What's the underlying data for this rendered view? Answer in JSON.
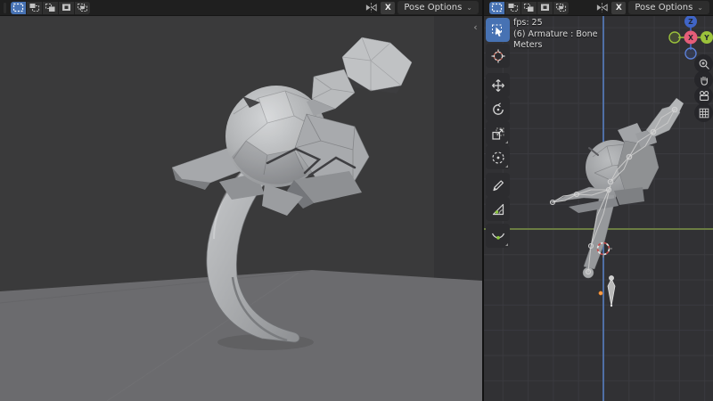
{
  "icons": {
    "chevron_down": "⌄",
    "sidebar_toggle": "‹"
  },
  "header": {
    "select_mode_tools": [
      "set",
      "extend",
      "subtract",
      "invert",
      "intersect"
    ],
    "mirror_axis_label": "X",
    "pose_options_label": "Pose Options"
  },
  "left_viewport": {
    "content": "shaded low-poly creature model on curved stand over gray floor plane"
  },
  "right_viewport": {
    "stats": {
      "fps": "fps: 25",
      "object_info": "(6) Armature : Bone",
      "units": "Meters"
    },
    "gizmo_axes": {
      "x": "X",
      "y": "Y",
      "z": "Z"
    },
    "toolbar_tools": [
      "select-box",
      "cursor",
      "move",
      "rotate",
      "scale",
      "transform",
      "annotate",
      "measure",
      "pose-breakdowner"
    ],
    "nav_controls": [
      "zoom",
      "pan",
      "toggle-camera-view",
      "toggle-orthographic"
    ]
  },
  "colors": {
    "accent_blue": "#4772b3",
    "axis_x_red": "#e45d79",
    "axis_y_green": "#9bc23b",
    "axis_z_blue": "#4065c7",
    "axis_y_line": "#6b7c42",
    "axis_z_line": "#4f6fa5",
    "origin_orange": "#ff9d45",
    "header_bg": "#1f1f1f",
    "left_scene_bg": "#3a3a3b",
    "right_scene_bg": "#313134",
    "floor_gray": "#6b6b6e"
  }
}
